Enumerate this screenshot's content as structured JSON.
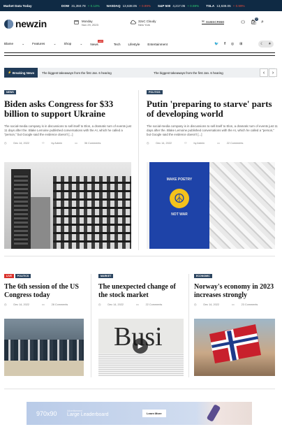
{
  "ticker": {
    "label": "Market Data Today",
    "items": [
      {
        "name": "DOW",
        "value": "31,350.78",
        "change": "+ 0.13%",
        "down": false
      },
      {
        "name": "NASDAQ",
        "value": "13,638.05",
        "change": "+ 0.99%",
        "down": true
      },
      {
        "name": "S&P 500",
        "value": "4,217.05",
        "change": "+ 0.59%",
        "down": false
      },
      {
        "name": "TSLA",
        "value": "13,638.05",
        "change": "+ 0.99%",
        "down": true
      }
    ]
  },
  "header": {
    "logo": "newzin",
    "day": "Monday",
    "date": "Nov 29, 2023",
    "weather": "32oC Cloudy",
    "city": "New York",
    "subscribe": "SUBSCRIBE",
    "cart_count": "0"
  },
  "nav": {
    "items": [
      "Blame",
      "Features",
      "Shop",
      "News",
      "Tech",
      "Lifestyle",
      "Entertainment"
    ],
    "news_badge": "HOT"
  },
  "breaking": {
    "label": "Breaking News",
    "text1": "The biggest takeaways from the first Jan. 6 hearing",
    "text2": "The biggest takeaways from the first Jan. 6 hearing"
  },
  "articles": {
    "a1": {
      "cat": "NEWS",
      "title": "Biden asks Congress for $33 billion to support Ukraine",
      "excerpt": "The social-media company is in discussions to sell itself to Elon, a dramatic turn of events just 11 days after the. Blake Lemoine published conversations with the AI, which he called a \"person,\" but Google said the evidence doesn't [...]",
      "date": "Dec 14, 2022",
      "author": "by Admin",
      "comments": "36 Comments"
    },
    "a2": {
      "cat": "POLITICS",
      "title": "Putin 'preparing to starve' parts of developing world",
      "excerpt": "The social-media company is in discussions to sell itself to Elon, a dramatic turn of events just 11 days after the. Blake Lemoine published conversations with the AI, which he called a \"person,\" but Google said the evidence doesn't [...]",
      "date": "Dec 14, 2022",
      "author": "by Admin",
      "comments": "22 Comments",
      "poster": [
        "MAKE POETRY",
        "NOT WAR"
      ]
    },
    "a3": {
      "cat_live": "LIVE",
      "cat": "POLITICS",
      "title": "The 6th session of the US Congress today",
      "date": "Dec 14, 2022",
      "comments": "28 Comments"
    },
    "a4": {
      "cat": "MARKET",
      "title": "The unexpected change of the stock market",
      "date": "Dec 14, 2022",
      "comments": "22 Comments",
      "newspaper_word": "Busi"
    },
    "a5": {
      "cat": "ECONOMIC",
      "title": "Norway's economy in 2023 increases strongly",
      "date": "Dec 14, 2022",
      "comments": "23 Comments"
    }
  },
  "ad": {
    "size": "970x90",
    "small": "Advertisement",
    "title": "Large Leaderboard",
    "button": "Learn More"
  }
}
